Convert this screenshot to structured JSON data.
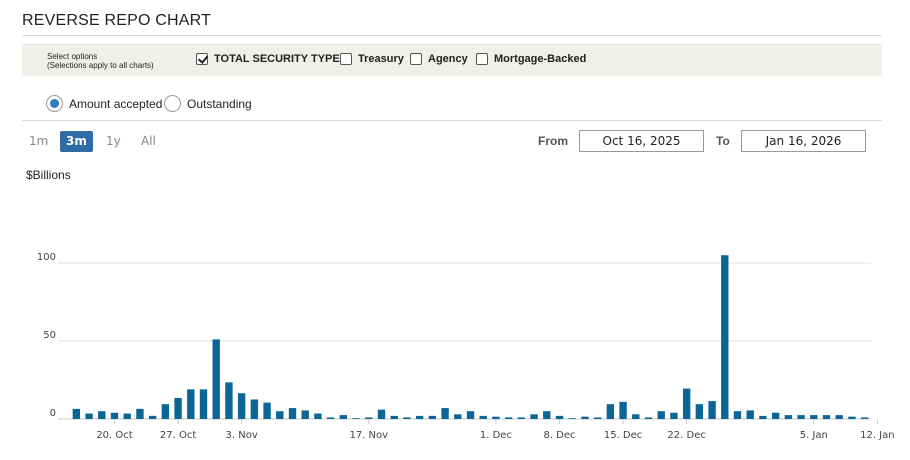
{
  "page": {
    "title": "REVERSE REPO CHART"
  },
  "options": {
    "help_line1": "Select options",
    "help_line2": "(Selections apply to all charts)",
    "checkboxes": [
      {
        "label": "TOTAL SECURITY TYPES",
        "checked": true
      },
      {
        "label": "Treasury",
        "checked": false
      },
      {
        "label": "Agency",
        "checked": false
      },
      {
        "label": "Mortgage-Backed",
        "checked": false
      }
    ]
  },
  "metric": {
    "options": [
      {
        "label": "Amount accepted",
        "selected": true
      },
      {
        "label": "Outstanding",
        "selected": false
      }
    ]
  },
  "range": {
    "buttons": [
      {
        "label": "1m",
        "active": false
      },
      {
        "label": "3m",
        "active": true
      },
      {
        "label": "1y",
        "active": false
      },
      {
        "label": "All",
        "active": false
      }
    ],
    "from_label": "From",
    "from_value": "Oct 16, 2025",
    "to_label": "To",
    "to_value": "Jan 16, 2026"
  },
  "chart_data": {
    "type": "bar",
    "ylabel": "$Billions",
    "ylim": [
      0,
      110
    ],
    "yticks": [
      0,
      50,
      100
    ],
    "series_color": "#0b6696",
    "grid": "horizontal",
    "xticks": [
      "20. Oct",
      "27. Oct",
      "3. Nov",
      "17. Nov",
      "1. Dec",
      "8. Dec",
      "15. Dec",
      "22. Dec",
      "5. Jan",
      "12. Jan"
    ],
    "xtick_positions": [
      3,
      8,
      13,
      23,
      33,
      38,
      43,
      48,
      58,
      63
    ],
    "values": [
      6.5,
      3.5,
      5,
      4,
      3.5,
      6.5,
      2,
      9.5,
      13.5,
      19,
      19,
      51,
      23.5,
      16.5,
      12.5,
      10.5,
      5,
      7,
      5.5,
      3.5,
      1,
      2.5,
      0.3,
      1,
      6,
      2,
      1,
      2,
      2,
      7,
      3,
      5,
      2,
      1.5,
      1,
      1,
      3,
      5,
      2,
      0.5,
      1.5,
      1,
      9.5,
      11,
      3,
      1,
      5,
      4,
      19.5,
      9.5,
      11.5,
      105,
      5,
      5.5,
      2,
      4,
      2.5,
      2.5,
      2.5,
      2.5,
      2.5,
      1.5,
      1
    ]
  }
}
